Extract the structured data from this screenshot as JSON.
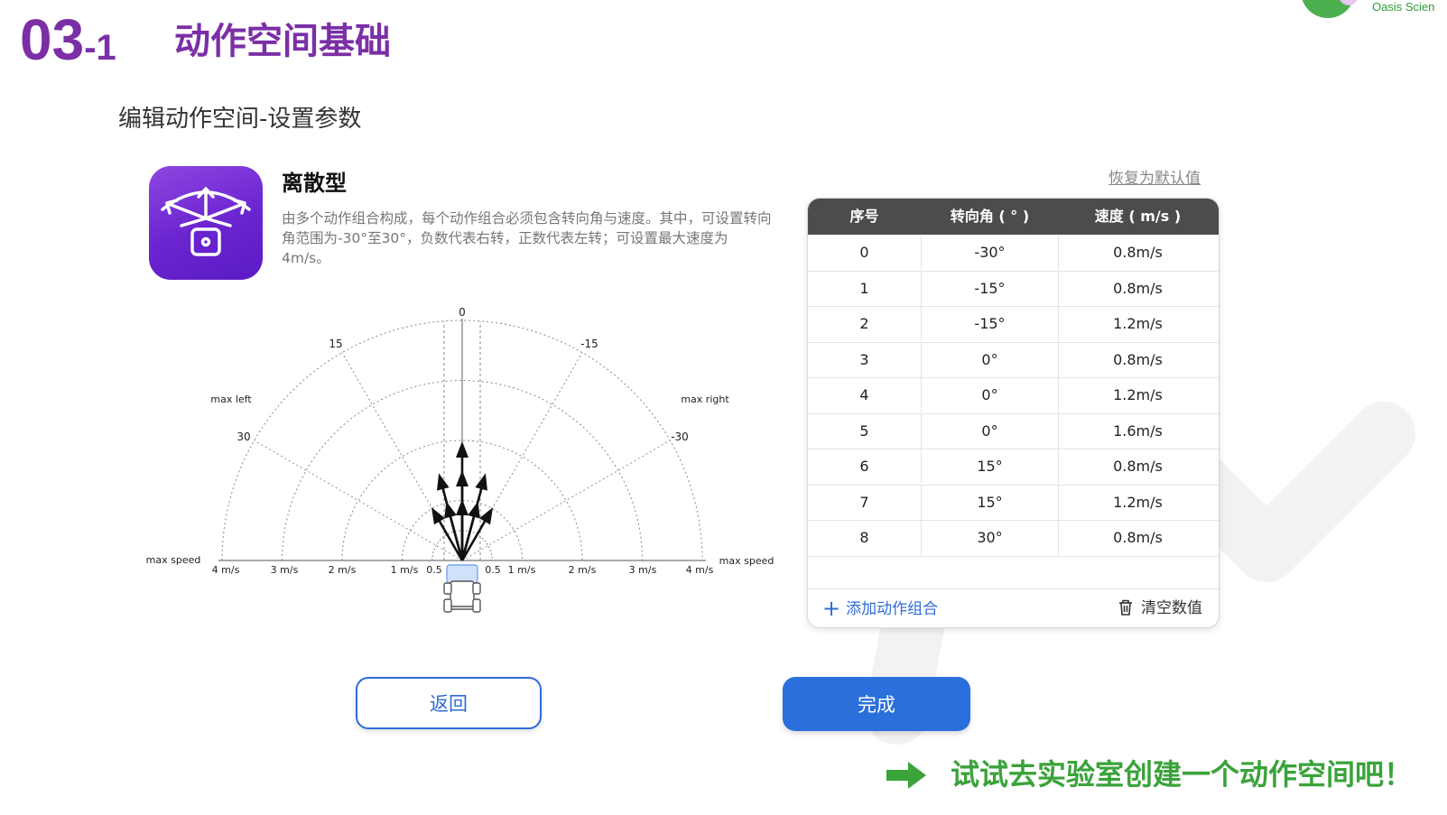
{
  "header": {
    "section_number": "03",
    "section_sub": "-1",
    "title": "动作空间基础",
    "subtitle": "编辑动作空间-设置参数"
  },
  "logo": {
    "text": "Oasis Scien"
  },
  "action_type": {
    "icon": "steering-fan-icon",
    "title": "离散型",
    "description": "由多个动作组合构成，每个动作组合必须包含转向角与速度。其中，可设置转向角范围为-30°至30°，负数代表右转，正数代表左转；可设置最大速度为4m/s。"
  },
  "diagram": {
    "angle_labels": {
      "zero": "0",
      "left15": "15",
      "right15": "-15",
      "left30": "30",
      "right30": "-30"
    },
    "side_labels": {
      "max_left": "max left",
      "max_right": "max right",
      "max_speed_left": "max speed",
      "max_speed_right": "max speed"
    },
    "speed_labels_left": [
      "4 m/s",
      "3 m/s",
      "2 m/s",
      "1 m/s",
      "0.5"
    ],
    "speed_labels_right": [
      "0.5",
      "1 m/s",
      "2 m/s",
      "3 m/s",
      "4 m/s"
    ]
  },
  "table": {
    "restore_default": "恢复为默认值",
    "headers": [
      "序号",
      "转向角 ( ° )",
      "速度 ( m/s )"
    ],
    "rows": [
      [
        "0",
        "-30°",
        "0.8m/s"
      ],
      [
        "1",
        "-15°",
        "0.8m/s"
      ],
      [
        "2",
        "-15°",
        "1.2m/s"
      ],
      [
        "3",
        "0°",
        "0.8m/s"
      ],
      [
        "4",
        "0°",
        "1.2m/s"
      ],
      [
        "5",
        "0°",
        "1.6m/s"
      ],
      [
        "6",
        "15°",
        "0.8m/s"
      ],
      [
        "7",
        "15°",
        "1.2m/s"
      ],
      [
        "8",
        "30°",
        "0.8m/s"
      ]
    ],
    "add_label": "添加动作组合",
    "clear_label": "清空数值"
  },
  "actions": {
    "values": [
      {
        "angle": -30,
        "speed": 0.8
      },
      {
        "angle": -15,
        "speed": 0.8
      },
      {
        "angle": -15,
        "speed": 1.2
      },
      {
        "angle": 0,
        "speed": 0.8
      },
      {
        "angle": 0,
        "speed": 1.2
      },
      {
        "angle": 0,
        "speed": 1.6
      },
      {
        "angle": 15,
        "speed": 0.8
      },
      {
        "angle": 15,
        "speed": 1.2
      },
      {
        "angle": 30,
        "speed": 0.8
      }
    ]
  },
  "buttons": {
    "back": "返回",
    "done": "完成"
  },
  "cta": {
    "text": "试试去实验室创建一个动作空间吧！"
  },
  "colors": {
    "purple": "#7b2fa6",
    "blue": "#2a6fdb",
    "green": "#3aa33a",
    "table_header": "#4c4c4c"
  }
}
